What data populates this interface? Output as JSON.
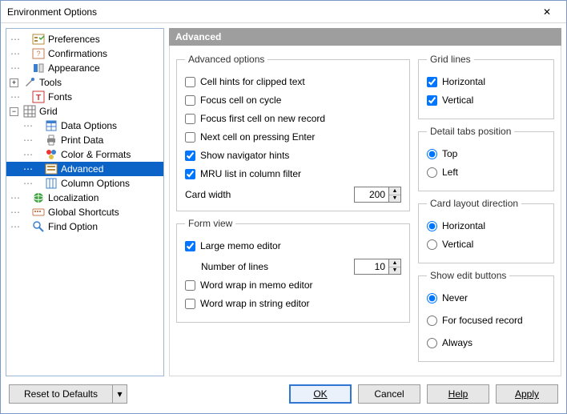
{
  "window_title": "Environment Options",
  "close_icon": "✕",
  "tree": {
    "items": [
      {
        "label": "Preferences"
      },
      {
        "label": "Confirmations"
      },
      {
        "label": "Appearance"
      },
      {
        "label": "Tools"
      },
      {
        "label": "Fonts"
      },
      {
        "label": "Grid"
      },
      {
        "label": "Data Options"
      },
      {
        "label": "Print Data"
      },
      {
        "label": "Color & Formats"
      },
      {
        "label": "Advanced"
      },
      {
        "label": "Column Options"
      },
      {
        "label": "Localization"
      },
      {
        "label": "Global Shortcuts"
      },
      {
        "label": "Find Option"
      }
    ]
  },
  "section_header": "Advanced",
  "advanced_options": {
    "legend": "Advanced options",
    "cell_hints": "Cell hints for clipped text",
    "focus_cycle": "Focus cell on cycle",
    "focus_first": "Focus first cell on new record",
    "next_enter": "Next cell on pressing Enter",
    "show_nav": "Show navigator hints",
    "mru": "MRU list in column filter",
    "card_width_label": "Card width",
    "card_width_value": "200"
  },
  "form_view": {
    "legend": "Form view",
    "large_memo": "Large memo editor",
    "num_lines_label": "Number of lines",
    "num_lines_value": "10",
    "wrap_memo": "Word wrap in memo editor",
    "wrap_string": "Word wrap in string editor"
  },
  "grid_lines": {
    "legend": "Grid lines",
    "horizontal": "Horizontal",
    "vertical": "Vertical"
  },
  "detail_tabs": {
    "legend": "Detail tabs position",
    "top": "Top",
    "left": "Left"
  },
  "card_layout": {
    "legend": "Card layout direction",
    "horizontal": "Horizontal",
    "vertical": "Vertical"
  },
  "show_edit": {
    "legend": "Show edit buttons",
    "never": "Never",
    "focused": "For focused record",
    "always": "Always"
  },
  "footer": {
    "reset": "Reset to Defaults",
    "dd": "▾",
    "ok": "OK",
    "cancel": "Cancel",
    "help": "Help",
    "apply": "Apply"
  }
}
